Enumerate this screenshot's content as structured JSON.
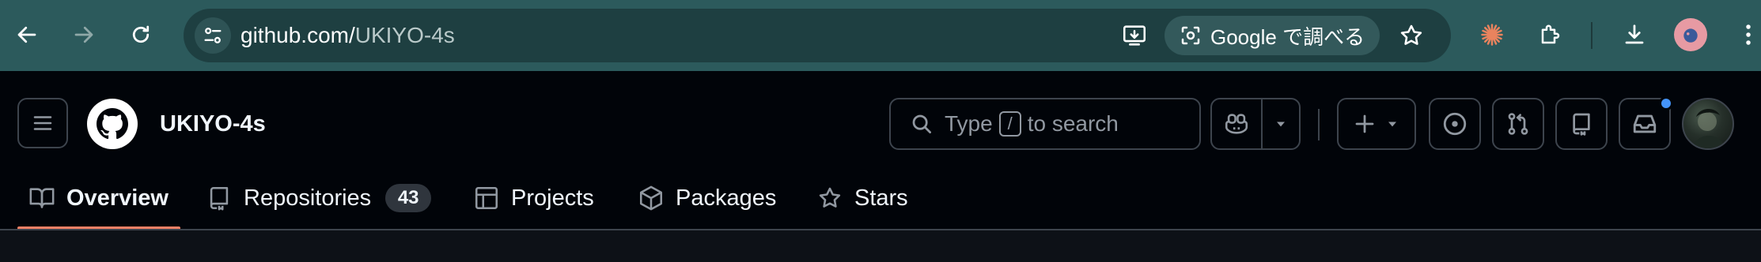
{
  "browser": {
    "url_host": "github.com/",
    "url_path": "UKIYO-4s",
    "lens_label": "Google で調べる",
    "accent": "#2c5a5c"
  },
  "header": {
    "owner": "UKIYO-4s",
    "search_text_before": "Type",
    "search_key": "/",
    "search_text_after": "to search"
  },
  "tabs": [
    {
      "label": "Overview",
      "icon": "book-icon",
      "selected": true
    },
    {
      "label": "Repositories",
      "icon": "repo-icon",
      "count": "43"
    },
    {
      "label": "Projects",
      "icon": "table-icon"
    },
    {
      "label": "Packages",
      "icon": "package-icon"
    },
    {
      "label": "Stars",
      "icon": "star-icon"
    }
  ],
  "colors": {
    "header_bg": "#010409",
    "underline": "#f78166",
    "notification": "#4493f8"
  }
}
